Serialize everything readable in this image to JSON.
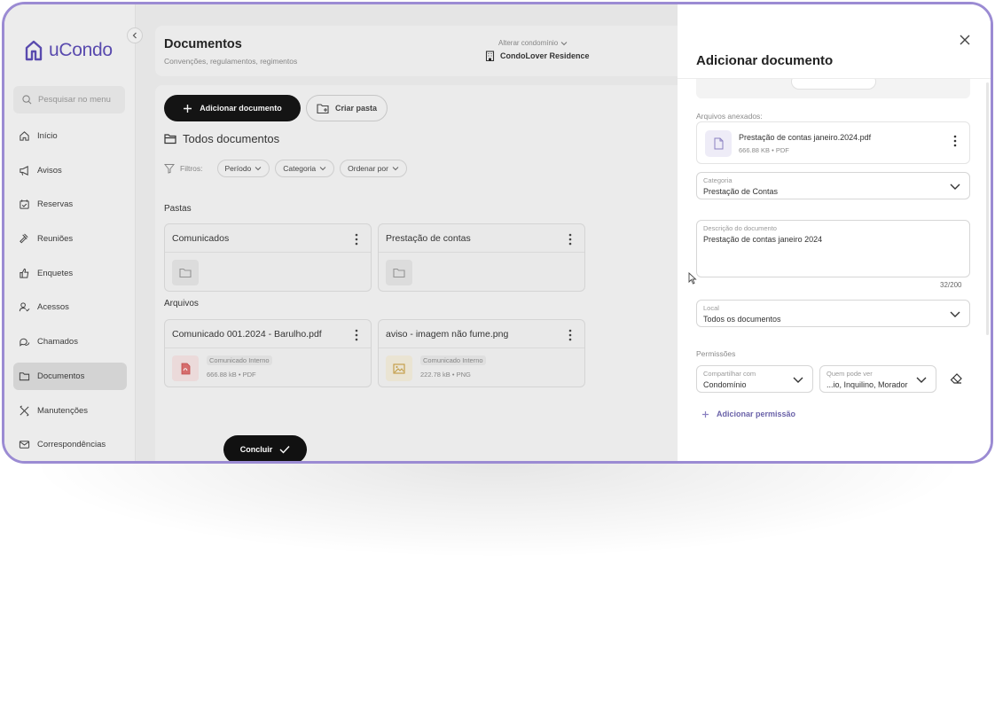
{
  "app": {
    "brand": "uCondo",
    "brand_color": "#5b4bb5",
    "frame_color": "#9b8bd3"
  },
  "sidebar": {
    "search_placeholder": "Pesquisar no menu",
    "items": [
      {
        "label": "Início",
        "icon": "home-icon"
      },
      {
        "label": "Avisos",
        "icon": "megaphone-icon"
      },
      {
        "label": "Reservas",
        "icon": "calendar-check-icon"
      },
      {
        "label": "Reuniões",
        "icon": "gavel-icon"
      },
      {
        "label": "Enquetes",
        "icon": "thumbs-up-icon"
      },
      {
        "label": "Acessos",
        "icon": "user-check-icon"
      },
      {
        "label": "Chamados",
        "icon": "chat-icon"
      },
      {
        "label": "Documentos",
        "icon": "folder-icon",
        "active": true
      },
      {
        "label": "Manutenções",
        "icon": "tools-icon"
      },
      {
        "label": "Correspondências",
        "icon": "mail-icon"
      }
    ]
  },
  "header": {
    "title": "Documentos",
    "subtitle": "Convenções, regulamentos, regimentos",
    "condo_label": "Alterar condomínio",
    "condo_name": "CondoLover Residence"
  },
  "toolbar": {
    "add_document": "Adicionar documento",
    "create_folder": "Criar pasta"
  },
  "content": {
    "section_title": "Todos documentos",
    "filters_label": "Filtros:",
    "filters": [
      "Período",
      "Categoria",
      "Ordenar por"
    ],
    "folders_heading": "Pastas",
    "folders": [
      {
        "name": "Comunicados"
      },
      {
        "name": "Prestação de contas"
      }
    ],
    "files_heading": "Arquivos",
    "files": [
      {
        "name": "Comunicado 001.2024 - Barulho.pdf",
        "tag": "Comunicado Interno",
        "meta": "666.88 kB • PDF",
        "icon": "pdf-file-icon"
      },
      {
        "name": "aviso - imagem não fume.png",
        "tag": "Comunicado Interno",
        "meta": "222.78 kB • PNG",
        "icon": "image-file-icon"
      }
    ]
  },
  "drawer": {
    "title": "Adicionar documento",
    "attachments_label": "Arquivos anexados:",
    "attachment": {
      "name": "Prestação de contas janeiro.2024.pdf",
      "meta": "666.88 KB • PDF"
    },
    "category": {
      "label": "Categoria",
      "value": "Prestação de Contas"
    },
    "description": {
      "label": "Descrição do documento",
      "value": "Prestação de contas janeiro 2024",
      "counter": "32/200"
    },
    "location": {
      "label": "Local",
      "value": "Todos os documentos"
    },
    "permissions_label": "Permissões",
    "share_with": {
      "label": "Compartilhar com",
      "value": "Condomínio"
    },
    "who_can_see": {
      "label": "Quem pode ver",
      "value": "...io, Inquilino, Morador"
    },
    "add_permission": "Adicionar permissão",
    "conclude": "Concluir"
  }
}
